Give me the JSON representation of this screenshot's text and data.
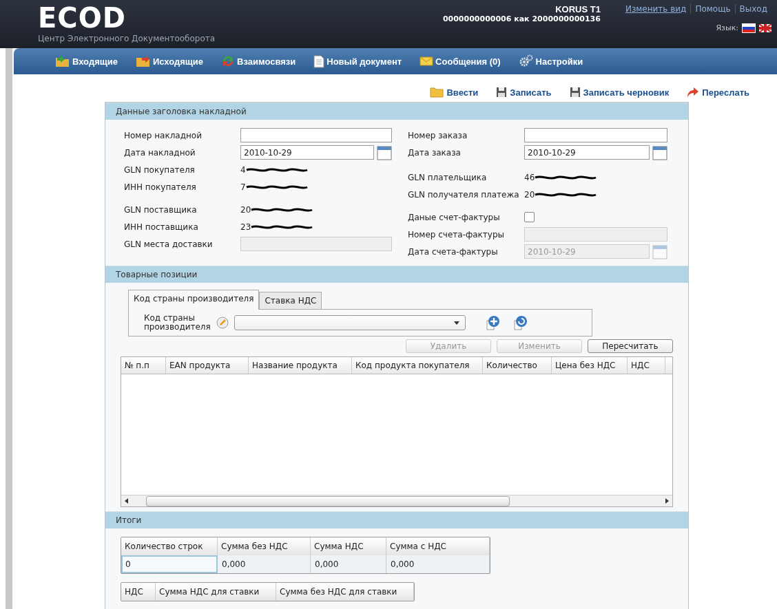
{
  "header": {
    "logo": "ECOD",
    "subtitle": "Центр Электронного Документооборота",
    "user": {
      "name": "KORUS T1",
      "account": "0000000000006 как 2000000000136"
    },
    "links": [
      "Изменить вид",
      "Помощь",
      "Выход"
    ],
    "language_label": "Язык:",
    "languages": [
      {
        "kind": "ru",
        "selected": true
      },
      {
        "kind": "uk",
        "selected": false
      }
    ]
  },
  "nav": [
    {
      "label": "Входящие",
      "kind": "incoming"
    },
    {
      "label": "Исходящие",
      "kind": "outgoing"
    },
    {
      "label": "Взаимосвязи",
      "kind": "links"
    },
    {
      "label": "Новый документ",
      "kind": "document"
    },
    {
      "label": "Сообщения (0)",
      "kind": "messages"
    },
    {
      "label": "Настройки",
      "kind": "settings"
    }
  ],
  "toolbar": [
    {
      "label": "Ввести",
      "kind": "folder"
    },
    {
      "label": "Записать",
      "kind": "save"
    },
    {
      "label": "Записать черновик",
      "kind": "save"
    },
    {
      "label": "Переслать",
      "kind": "forward"
    }
  ],
  "header_section": {
    "title": "Данные заголовка накладной",
    "left": [
      [
        {
          "label": "Номер накладной",
          "kind": "input",
          "disabled": false
        },
        {
          "label": "Дата накладной",
          "kind": "date",
          "value": "2010-10-29",
          "disabled": false
        },
        {
          "label": "GLN покупателя",
          "kind": "value",
          "value": "4",
          "redacted": true
        },
        {
          "label": "ИНН покупателя",
          "kind": "value",
          "value": "7",
          "redacted": true
        }
      ],
      [
        {
          "label": "GLN поставщика",
          "kind": "value",
          "value": "20",
          "redacted": true
        },
        {
          "label": "ИНН поставщика",
          "kind": "value",
          "value": "23",
          "redacted": true
        },
        {
          "label": "GLN места доставки",
          "kind": "input",
          "disabled": true
        }
      ]
    ],
    "right": [
      [
        {
          "label": "Номер заказа",
          "kind": "input",
          "disabled": false
        },
        {
          "label": "Дата заказа",
          "kind": "date",
          "value": "2010-10-29",
          "disabled": false
        }
      ],
      [
        {
          "label": "GLN плательщика",
          "kind": "value",
          "value": "46",
          "redacted": true
        },
        {
          "label": "GLN получателя платежа",
          "kind": "value",
          "value": "20",
          "redacted": true
        }
      ],
      [
        {
          "label": "Даные счет-фактуры",
          "kind": "checkbox",
          "checked": false
        },
        {
          "label": "Номер счета-фактуры",
          "kind": "input",
          "disabled": true
        },
        {
          "label": "Дата счета-фактуры",
          "kind": "date",
          "value": "2010-10-29",
          "disabled": true
        }
      ]
    ]
  },
  "items_section": {
    "title": "Товарные позиции",
    "tabs": [
      {
        "label": "Код страны производителя",
        "selected": true
      },
      {
        "label": "Ставка НДС",
        "selected": false
      }
    ],
    "country_label": "Код страны производителя",
    "buttons": [
      {
        "label": "Удалить",
        "disabled": true
      },
      {
        "label": "Изменить",
        "disabled": true
      },
      {
        "label": "Пересчитать",
        "disabled": false
      }
    ],
    "columns": [
      "№ п.п",
      "EAN продукта",
      "Название продукта",
      "Код продукта покупателя",
      "Количество",
      "Цена без НДС",
      "НДС"
    ]
  },
  "totals_section": {
    "title": "Итоги",
    "columns": [
      "Количество строк",
      "Сумма без НДС",
      "Сумма НДС",
      "Сумма с НДС"
    ],
    "row": [
      {
        "value": "0",
        "selected": true
      },
      {
        "value": "0,000",
        "selected": false
      },
      {
        "value": "0,000",
        "selected": false
      },
      {
        "value": "0,000",
        "selected": false
      }
    ],
    "vat_columns": [
      "НДС",
      "Сумма НДС для ставки",
      "Сумма без НДС для ставки"
    ]
  }
}
